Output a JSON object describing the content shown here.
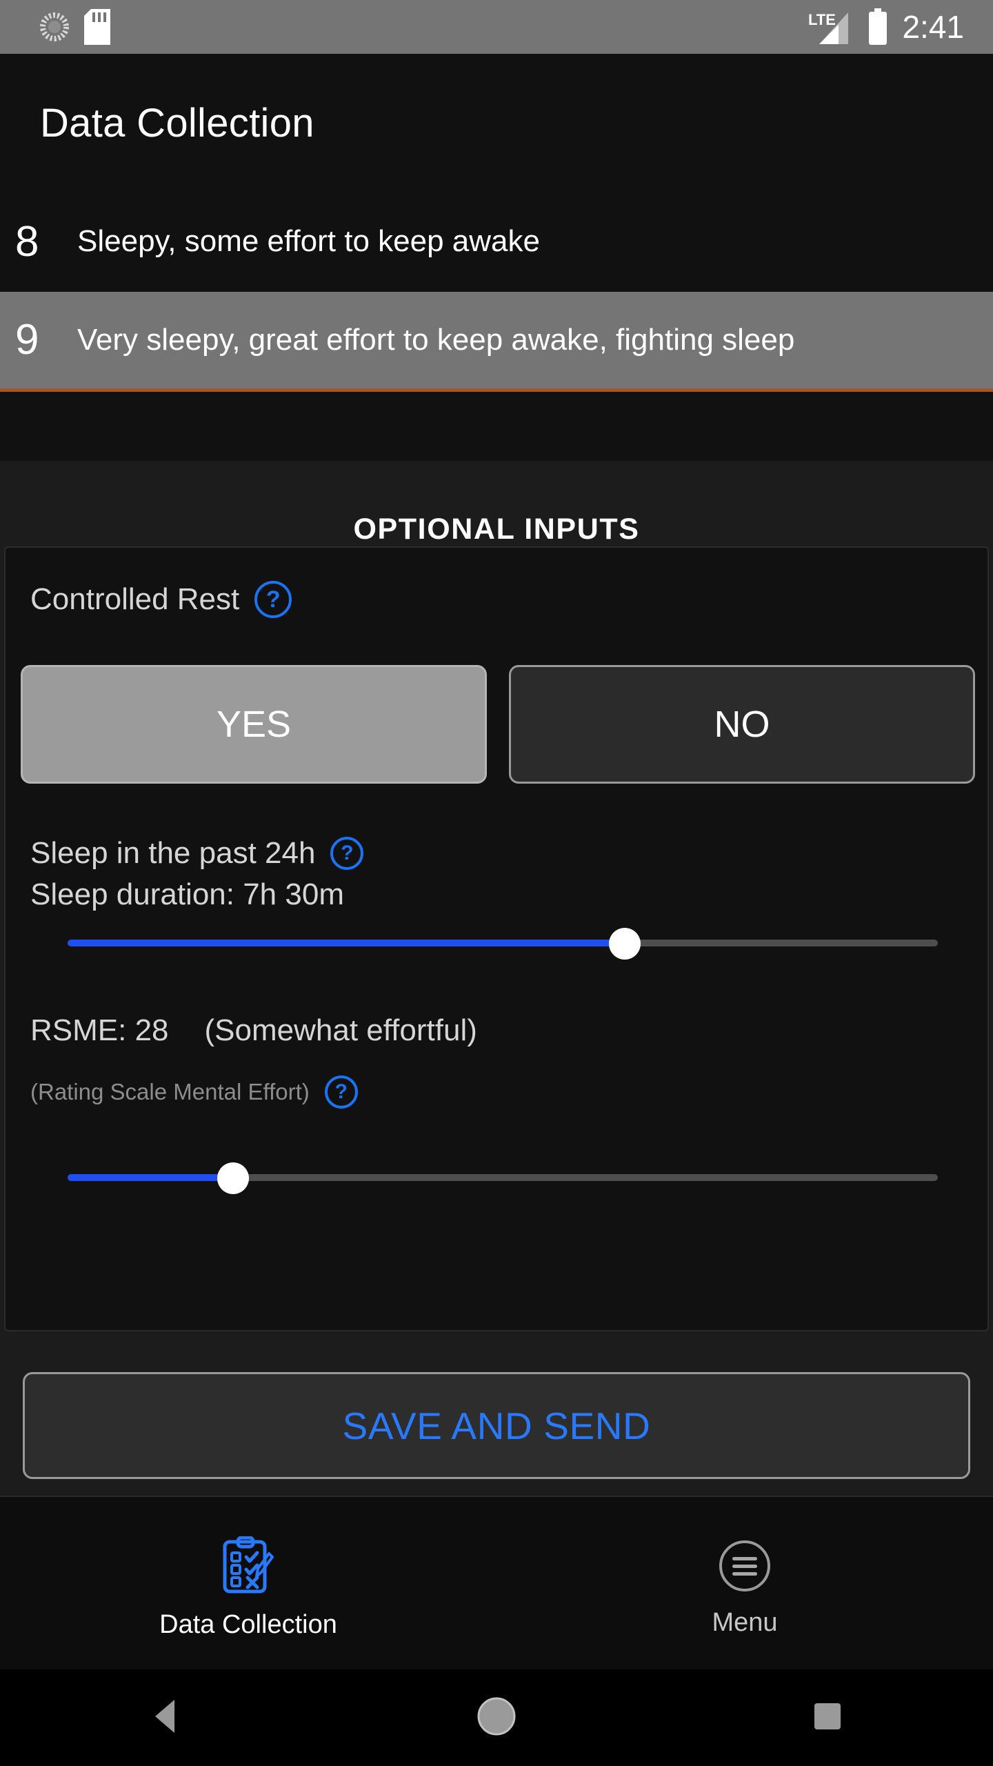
{
  "status_bar": {
    "time": "2:41",
    "network_label": "LTE",
    "icons": [
      "spinner-icon",
      "sd-card-icon",
      "signal-icon",
      "battery-icon"
    ]
  },
  "header": {
    "title": "Data Collection"
  },
  "kss_list": {
    "items": [
      {
        "number": "8",
        "label": "Sleepy, some effort to keep awake",
        "selected": false
      },
      {
        "number": "9",
        "label": "Very sleepy, great effort to keep awake, fighting sleep",
        "selected": true
      }
    ]
  },
  "optional_inputs": {
    "heading": "OPTIONAL INPUTS",
    "controlled_rest": {
      "label": "Controlled Rest",
      "help": "?",
      "yes_label": "YES",
      "no_label": "NO",
      "selected": "YES"
    },
    "sleep": {
      "label": "Sleep in the past 24h",
      "help": "?",
      "value_label": "Sleep duration: 7h 30m",
      "slider_percent": 64
    },
    "rsme": {
      "label": "RSME: 28",
      "descriptor": "(Somewhat effortful)",
      "sublabel": "(Rating Scale Mental Effort)",
      "help": "?",
      "slider_percent": 19
    }
  },
  "save": {
    "label": "SAVE AND SEND"
  },
  "bottom_nav": {
    "items": [
      {
        "label": "Data Collection",
        "icon": "clipboard-checklist-icon",
        "active": true
      },
      {
        "label": "Menu",
        "icon": "hamburger-circle-icon",
        "active": false
      }
    ]
  },
  "android_nav": {
    "back": "back-triangle-icon",
    "home": "home-circle-icon",
    "recents": "recents-square-icon"
  },
  "colors": {
    "accent_blue": "#2979ff",
    "slider_blue": "#1f4ff0",
    "selected_row": "#757575",
    "row_underline": "#a4552a",
    "status_bar": "#757575"
  }
}
